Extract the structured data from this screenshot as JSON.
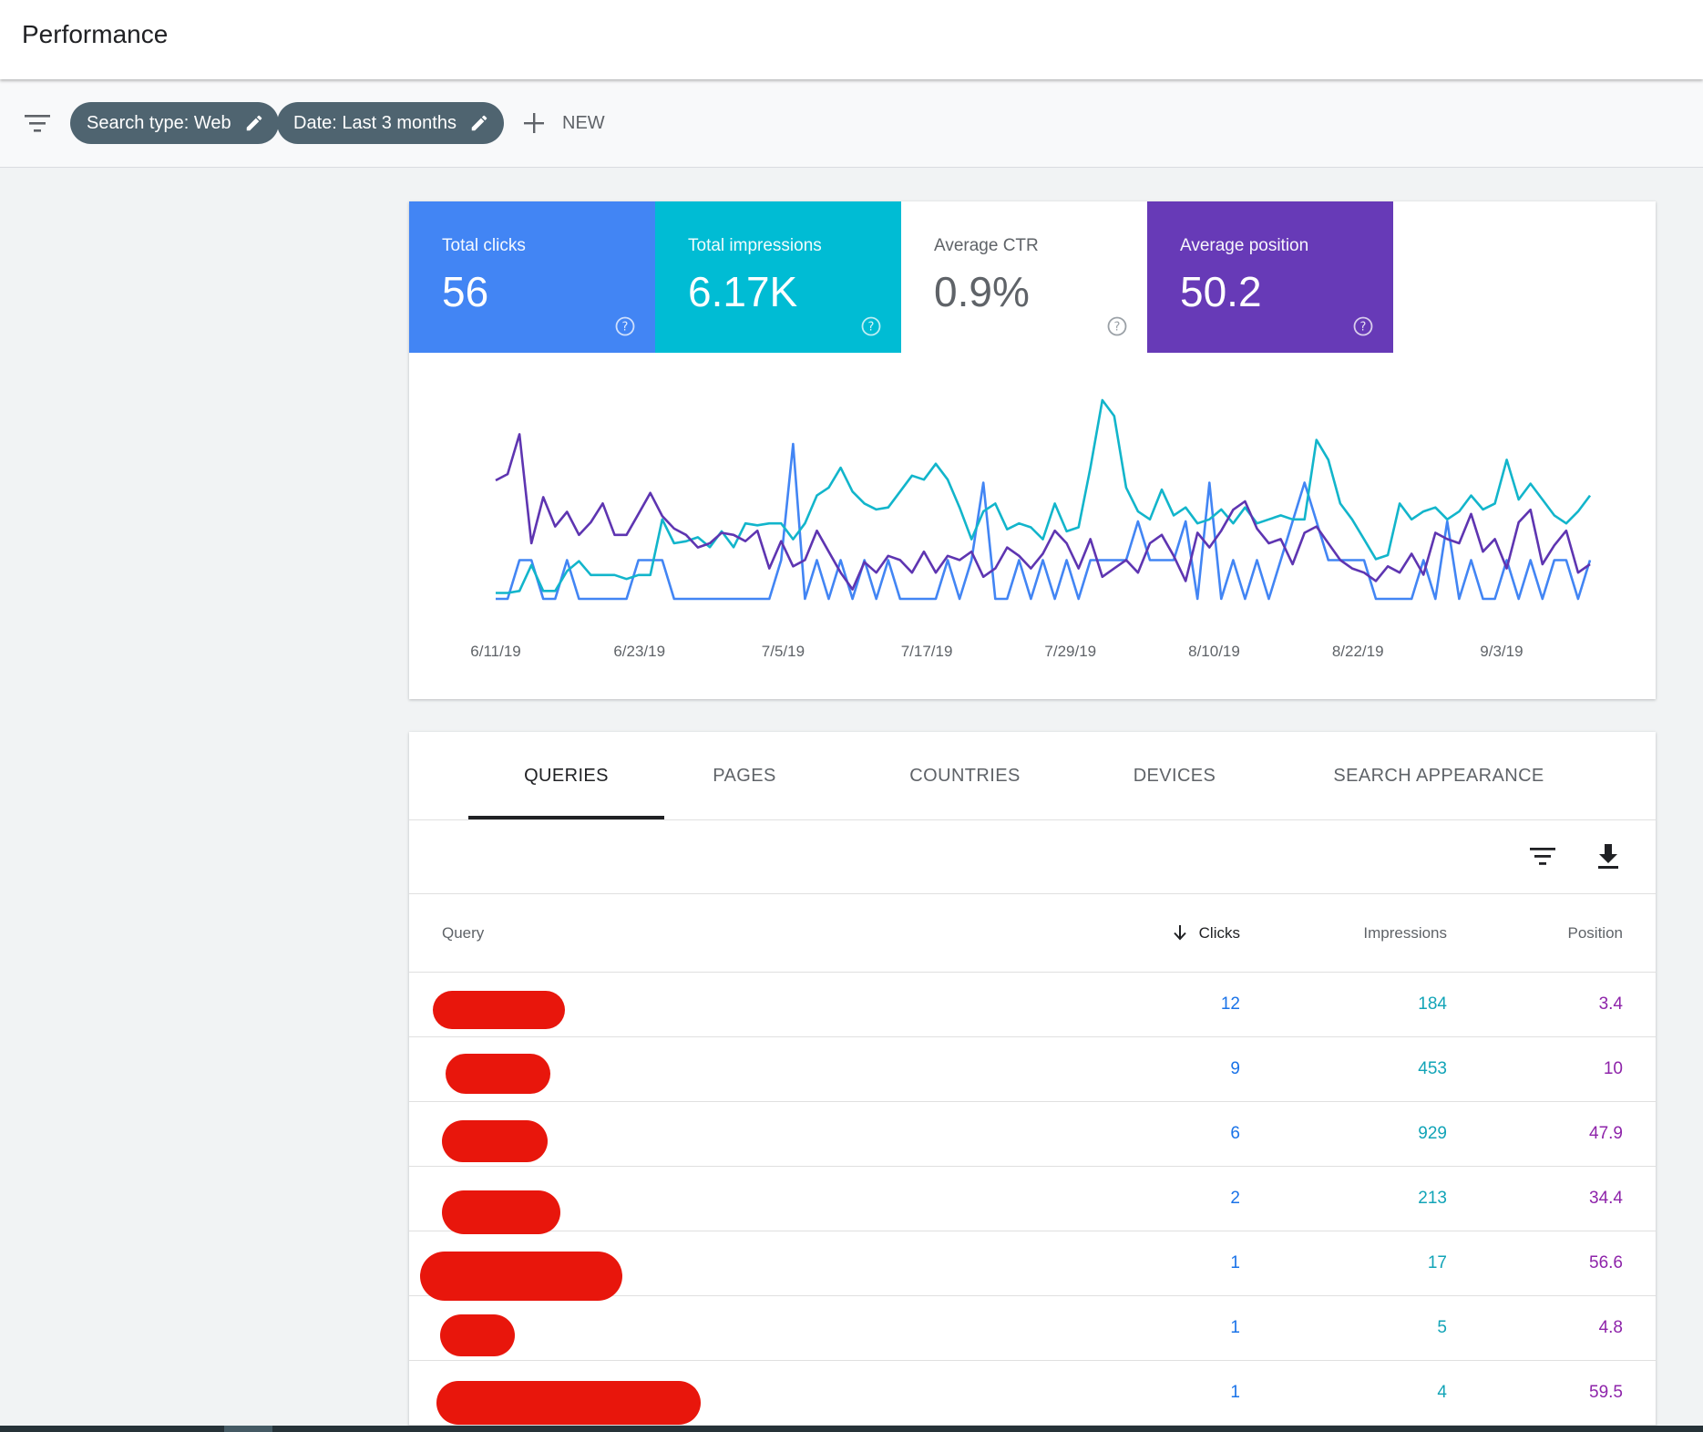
{
  "header": {
    "title": "Performance"
  },
  "filters": {
    "icon": "filter-list-icon",
    "chips": [
      {
        "label": "Search type: Web",
        "icon": "pencil-icon"
      },
      {
        "label": "Date: Last 3 months",
        "icon": "pencil-icon"
      }
    ],
    "new_label": "NEW"
  },
  "metrics": [
    {
      "label": "Total clicks",
      "value": "56",
      "color": "#4285f4",
      "active": true
    },
    {
      "label": "Total impressions",
      "value": "6.17K",
      "color": "#00bcd4",
      "active": true
    },
    {
      "label": "Average CTR",
      "value": "0.9%",
      "color": "#ffffff",
      "active": false
    },
    {
      "label": "Average position",
      "value": "50.2",
      "color": "#673ab7",
      "active": true
    }
  ],
  "chart_data": {
    "type": "line",
    "x_tick_labels": [
      "6/11/19",
      "6/23/19",
      "7/5/19",
      "7/17/19",
      "7/29/19",
      "8/10/19",
      "8/22/19",
      "9/3/19"
    ],
    "grid": false,
    "legend": "none",
    "series": [
      {
        "name": "Total clicks",
        "color": "#4285f4",
        "values": [
          0,
          0,
          1,
          1,
          0,
          0,
          1,
          0,
          0,
          0,
          0,
          0,
          1,
          1,
          1,
          0,
          0,
          0,
          0,
          0,
          0,
          0,
          0,
          0,
          1,
          4,
          0,
          1,
          0,
          1,
          0,
          1,
          0,
          1,
          0,
          0,
          0,
          0,
          1,
          0,
          1,
          3,
          0,
          0,
          1,
          0,
          1,
          0,
          1,
          0,
          1,
          1,
          1,
          1,
          2,
          1,
          1,
          1,
          2,
          0,
          3,
          0,
          1,
          0,
          1,
          0,
          1,
          2,
          3,
          2,
          1,
          1,
          1,
          1,
          0,
          0,
          0,
          0,
          1,
          0,
          2,
          0,
          1,
          0,
          0,
          1,
          0,
          1,
          0,
          1,
          1,
          0,
          1
        ]
      },
      {
        "name": "Total impressions",
        "color": "#12b5cb",
        "values": [
          3,
          3,
          4,
          17,
          4,
          4,
          14,
          19,
          12,
          12,
          12,
          10,
          12,
          12,
          40,
          28,
          29,
          31,
          26,
          34,
          26,
          38,
          37,
          38,
          38,
          30,
          38,
          52,
          56,
          66,
          54,
          48,
          45,
          46,
          54,
          62,
          60,
          68,
          60,
          46,
          30,
          44,
          48,
          35,
          38,
          36,
          30,
          48,
          34,
          36,
          66,
          100,
          92,
          56,
          44,
          40,
          55,
          42,
          46,
          38,
          40,
          45,
          38,
          46,
          38,
          40,
          42,
          40,
          40,
          80,
          70,
          48,
          40,
          30,
          20,
          22,
          48,
          40,
          44,
          46,
          40,
          44,
          52,
          45,
          48,
          70,
          50,
          58,
          50,
          42,
          38,
          44,
          52
        ]
      },
      {
        "name": "Average position",
        "color": "#5e35b1",
        "values": [
          40,
          37,
          18,
          70,
          48,
          62,
          55,
          66,
          60,
          51,
          66,
          66,
          56,
          46,
          57,
          63,
          66,
          72,
          70,
          65,
          66,
          69,
          64,
          82,
          69,
          81,
          78,
          64,
          74,
          84,
          92,
          79,
          84,
          76,
          78,
          84,
          74,
          84,
          76,
          78,
          74,
          86,
          82,
          72,
          76,
          82,
          75,
          64,
          70,
          82,
          68,
          86,
          82,
          78,
          84,
          70,
          66,
          76,
          88,
          65,
          72,
          64,
          54,
          50,
          63,
          70,
          68,
          80,
          65,
          62,
          70,
          78,
          82,
          84,
          88,
          81,
          84,
          75,
          85,
          65,
          68,
          70,
          56,
          74,
          68,
          82,
          60,
          54,
          80,
          71,
          64,
          84,
          80
        ]
      }
    ]
  },
  "tabs": [
    {
      "label": "QUERIES",
      "active": true
    },
    {
      "label": "PAGES",
      "active": false
    },
    {
      "label": "COUNTRIES",
      "active": false
    },
    {
      "label": "DEVICES",
      "active": false
    },
    {
      "label": "SEARCH APPEARANCE",
      "active": false
    }
  ],
  "table_tools": {
    "filter_icon": "filter-list-icon",
    "download_icon": "download-icon"
  },
  "table": {
    "columns": {
      "query": "Query",
      "clicks": "Clicks",
      "impressions": "Impressions",
      "position": "Position"
    },
    "sort_icon": "arrow-down-icon",
    "rows": [
      {
        "clicks": "12",
        "impressions": "184",
        "position": "3.4"
      },
      {
        "clicks": "9",
        "impressions": "453",
        "position": "10"
      },
      {
        "clicks": "6",
        "impressions": "929",
        "position": "47.9"
      },
      {
        "clicks": "2",
        "impressions": "213",
        "position": "34.4"
      },
      {
        "clicks": "1",
        "impressions": "17",
        "position": "56.6"
      },
      {
        "clicks": "1",
        "impressions": "5",
        "position": "4.8"
      },
      {
        "clicks": "1",
        "impressions": "4",
        "position": "59.5"
      }
    ]
  }
}
